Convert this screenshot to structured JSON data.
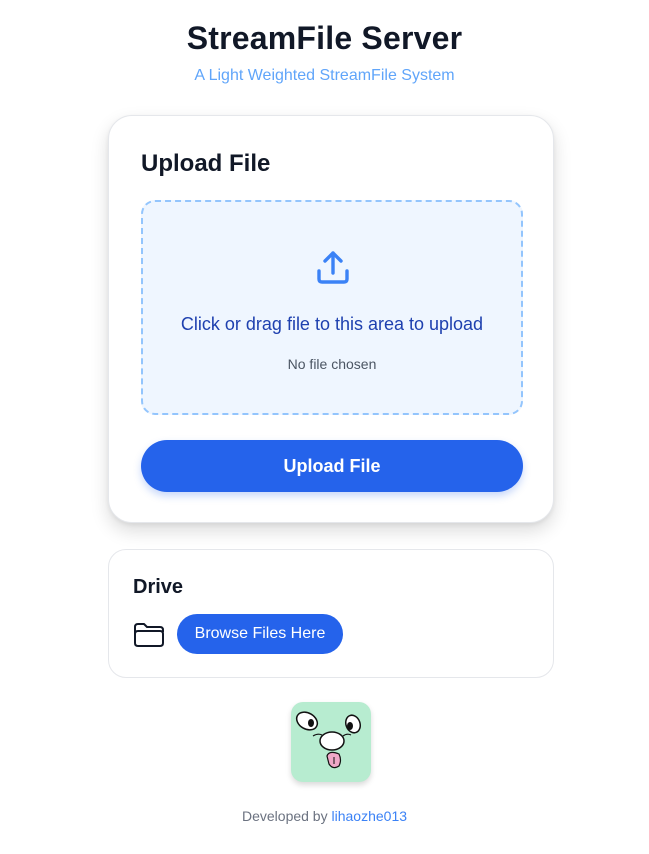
{
  "header": {
    "title": "StreamFile Server",
    "subtitle": "A Light Weighted StreamFile System"
  },
  "upload": {
    "title": "Upload File",
    "drop_text": "Click or drag file to this area to upload",
    "file_status": "No file chosen",
    "button_label": "Upload File",
    "icon": "upload-icon"
  },
  "drive": {
    "title": "Drive",
    "icon": "folder-icon",
    "browse_label": "Browse Files Here"
  },
  "footer": {
    "prefix": "Developed by",
    "author": "lihaozhe013"
  },
  "colors": {
    "accent": "#2563eb",
    "subtitle": "#60a5fa",
    "dropzone_bg": "#eff6ff",
    "dropzone_border": "#93c5fd",
    "avatar_bg": "#b7ecd0"
  }
}
